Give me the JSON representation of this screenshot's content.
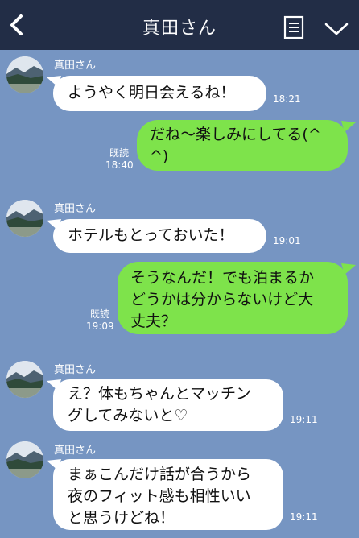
{
  "header": {
    "title": "真田さん",
    "back_icon": "chevron-left-icon",
    "note_icon": "note-icon",
    "menu_icon": "chevron-down-icon"
  },
  "colors": {
    "header_bg": "#222d46",
    "chat_bg": "#7695c2",
    "incoming_bubble": "#ffffff",
    "outgoing_bubble": "#7ee34b"
  },
  "messages": [
    {
      "direction": "incoming",
      "sender": "真田さん",
      "lines": [
        "ようやく明日会えるね！"
      ],
      "time": "18:21"
    },
    {
      "direction": "outgoing",
      "lines": [
        "だね〜楽しみにしてる(^",
        "^)"
      ],
      "read_label": "既読",
      "time": "18:40"
    },
    {
      "direction": "incoming",
      "sender": "真田さん",
      "lines": [
        "ホテルもとっておいた！"
      ],
      "time": "19:01"
    },
    {
      "direction": "outgoing",
      "lines": [
        "そうなんだ！でも泊まるか",
        "どうかは分からないけど大",
        "丈夫？"
      ],
      "read_label": "既読",
      "time": "19:09"
    },
    {
      "direction": "incoming",
      "sender": "真田さん",
      "lines": [
        "え？体もちゃんとマッチン",
        "グしてみないと♡"
      ],
      "time": "19:11"
    },
    {
      "direction": "incoming",
      "sender": "真田さん",
      "lines": [
        "まぁこんだけ話が合うから",
        "夜のフィット感も相性いい",
        "と思うけどね！"
      ],
      "time": "19:11"
    }
  ]
}
